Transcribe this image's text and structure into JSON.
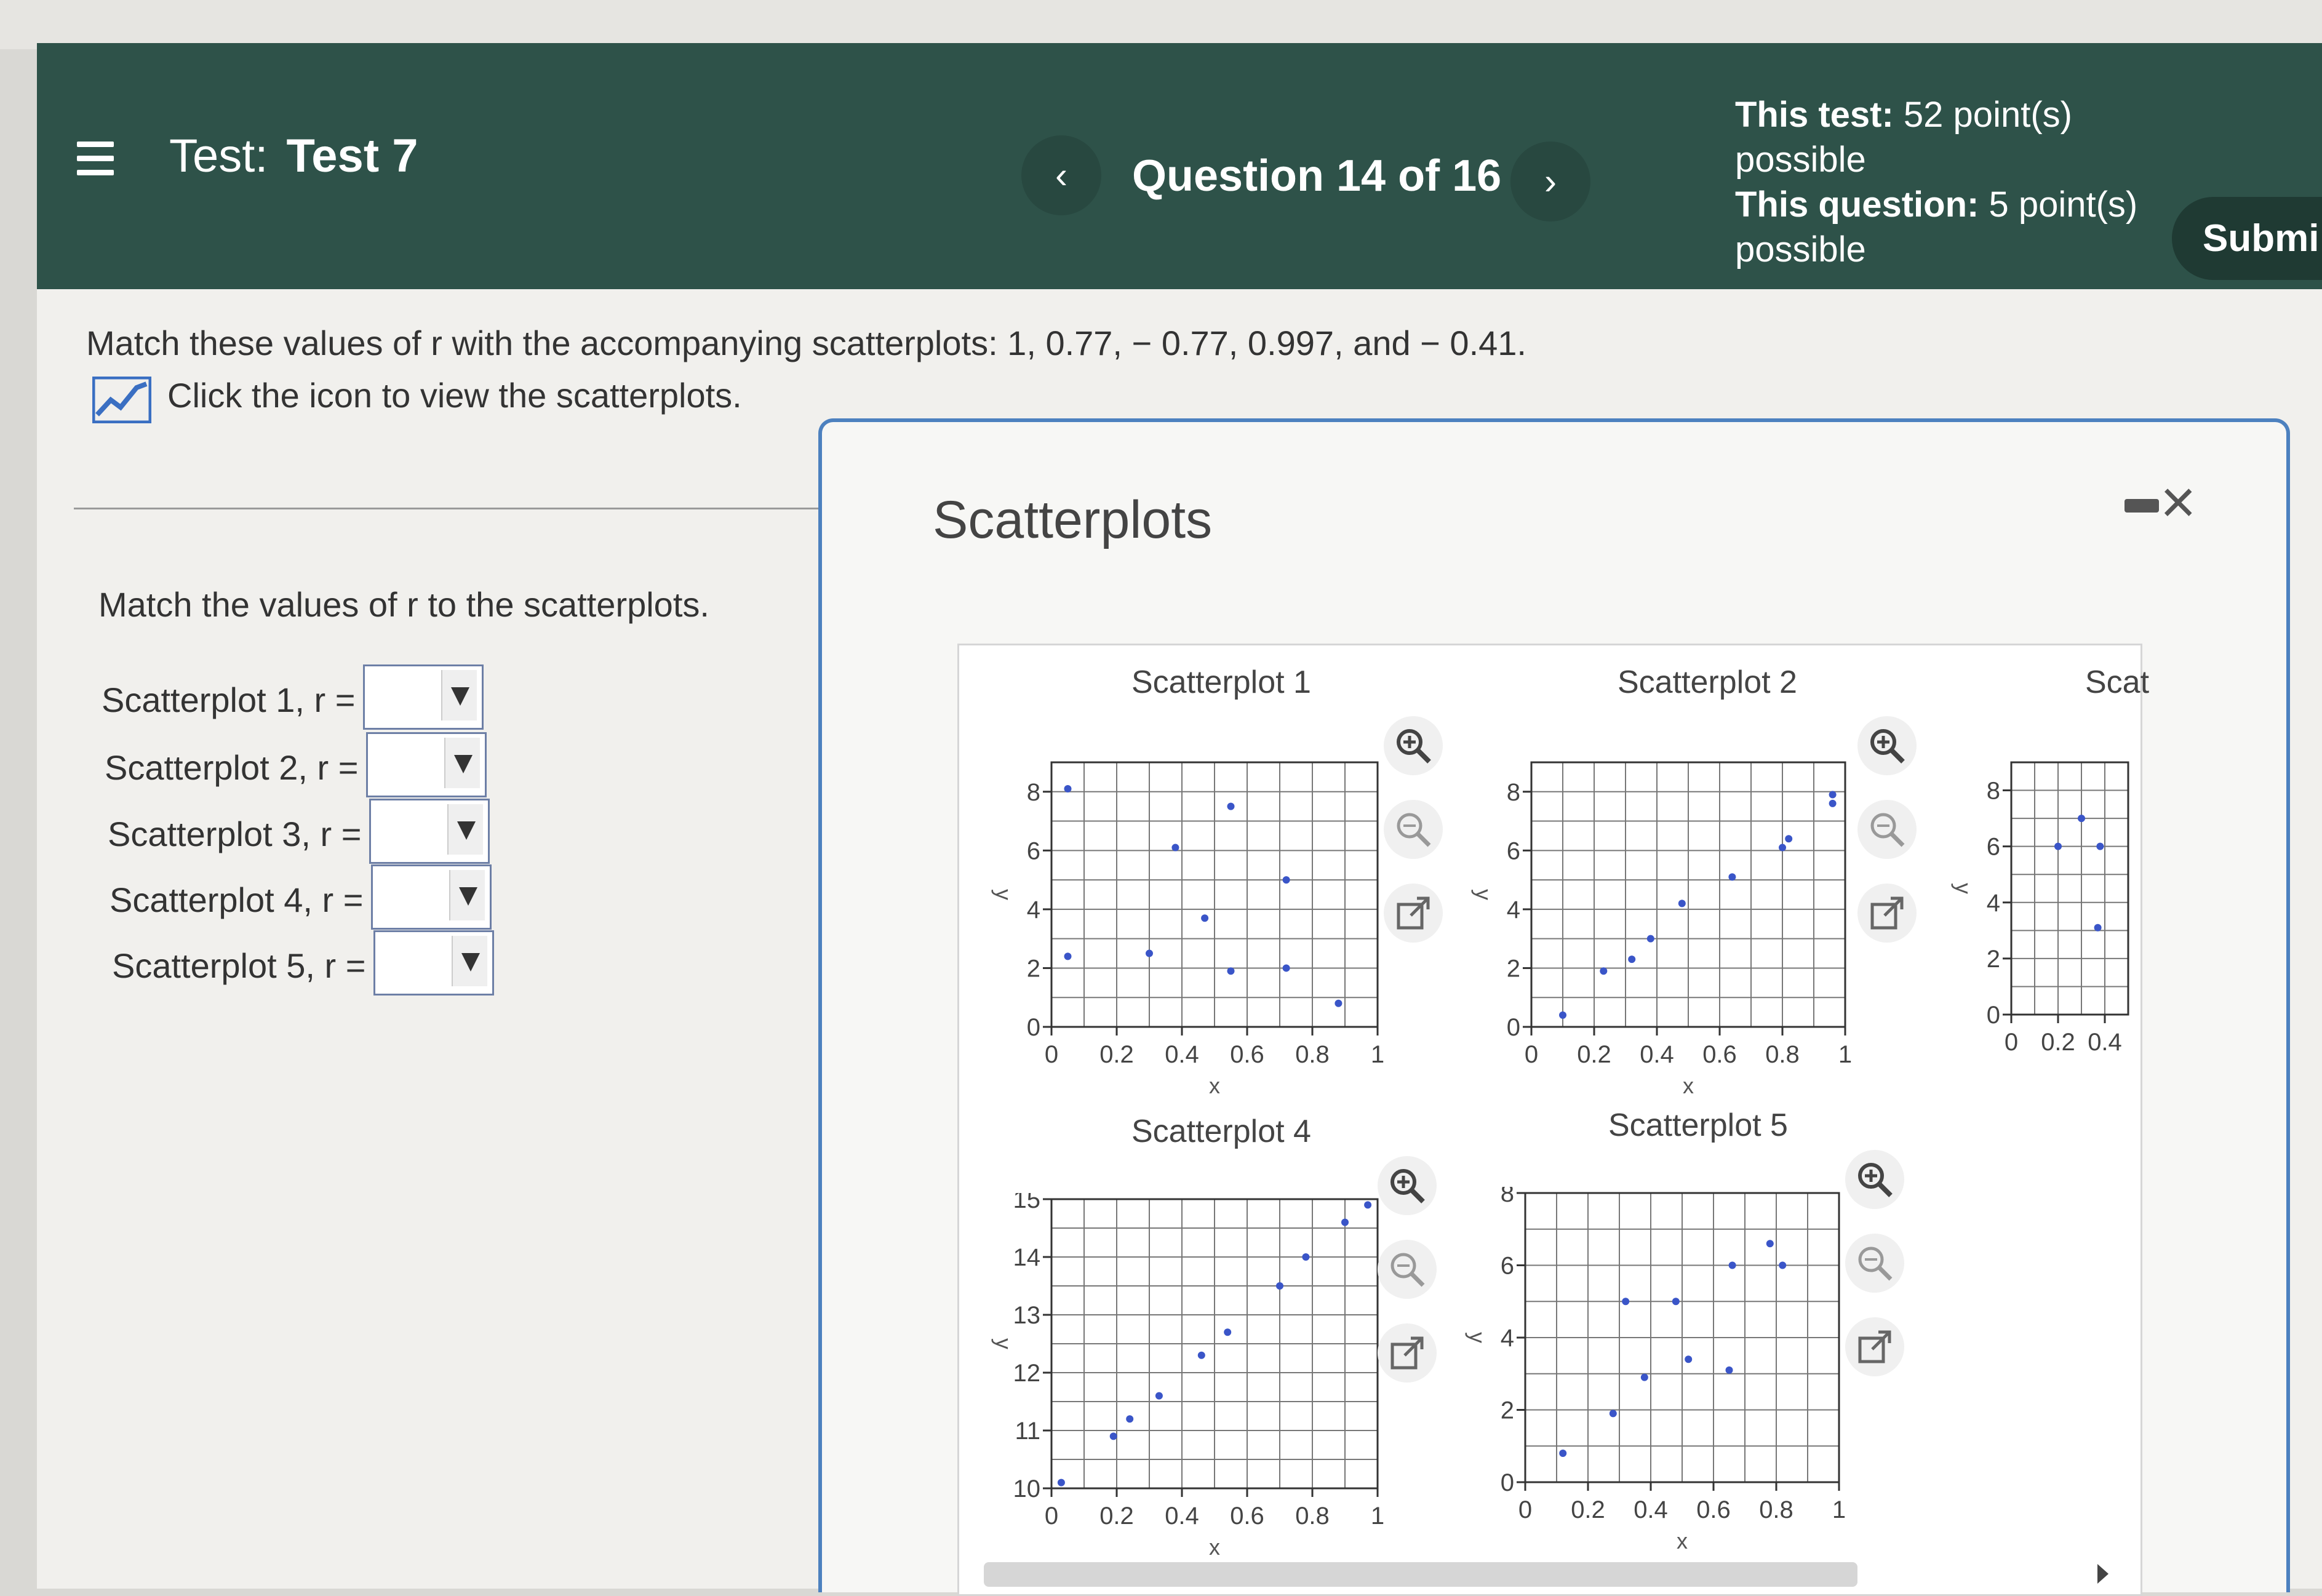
{
  "header": {
    "test_prefix": "Test:",
    "test_name": "Test 7",
    "question_label": "Question 14 of 16",
    "prev_symbol": "‹",
    "next_symbol": "›",
    "this_test_label": "This test:",
    "this_test_value": " 52 point(s) possible",
    "this_question_label": "This question:",
    "this_question_value": " 5 point(s) possible",
    "submit_label": "Submi"
  },
  "question": {
    "instructions": "Match these values of r with the accompanying scatterplots: 1, 0.77, − 0.77, 0.997, and − 0.41.",
    "view_link": "Click the icon to view the scatterplots.",
    "match_title": "Match the values of r to the scatterplots.",
    "rows": [
      {
        "label": "Scatterplot 1, r =",
        "value": ""
      },
      {
        "label": "Scatterplot 2, r =",
        "value": ""
      },
      {
        "label": "Scatterplot 3, r =",
        "value": ""
      },
      {
        "label": "Scatterplot 4, r =",
        "value": ""
      },
      {
        "label": "Scatterplot 5, r =",
        "value": ""
      }
    ]
  },
  "modal": {
    "title": "Scatterplots",
    "minimize_icon": "minimize-icon",
    "close_icon": "close-icon"
  },
  "colors": {
    "header_bg": "#2e5249",
    "modal_border": "#4d81bf",
    "point": "#3a55c8",
    "dropdown_border": "#6d7fa6"
  },
  "chart_data": [
    {
      "type": "scatter",
      "title": "Scatterplot 1",
      "xlabel": "x",
      "ylabel": "y",
      "xlim": [
        0,
        1
      ],
      "ylim": [
        0,
        9
      ],
      "xticks": [
        "0",
        "0.2",
        "0.4",
        "0.6",
        "0.8",
        "1"
      ],
      "yticks": [
        "0",
        "2",
        "4",
        "6",
        "8"
      ],
      "grid": true,
      "points": [
        [
          0.05,
          8.1
        ],
        [
          0.05,
          2.4
        ],
        [
          0.3,
          2.5
        ],
        [
          0.38,
          6.1
        ],
        [
          0.47,
          3.7
        ],
        [
          0.55,
          7.5
        ],
        [
          0.55,
          1.9
        ],
        [
          0.72,
          5.0
        ],
        [
          0.72,
          2.0
        ],
        [
          0.88,
          0.8
        ]
      ]
    },
    {
      "type": "scatter",
      "title": "Scatterplot 2",
      "xlabel": "x",
      "ylabel": "y",
      "xlim": [
        0,
        1
      ],
      "ylim": [
        0,
        9
      ],
      "xticks": [
        "0",
        "0.2",
        "0.4",
        "0.6",
        "0.8",
        "1"
      ],
      "yticks": [
        "0",
        "2",
        "4",
        "6",
        "8"
      ],
      "grid": true,
      "points": [
        [
          0.1,
          0.4
        ],
        [
          0.23,
          1.9
        ],
        [
          0.32,
          2.3
        ],
        [
          0.38,
          3.0
        ],
        [
          0.48,
          4.2
        ],
        [
          0.64,
          5.1
        ],
        [
          0.8,
          6.1
        ],
        [
          0.82,
          6.4
        ],
        [
          0.96,
          7.9
        ],
        [
          0.96,
          7.6
        ]
      ]
    },
    {
      "type": "scatter",
      "title": "Scat",
      "xlabel": "",
      "ylabel": "y",
      "xlim": [
        0,
        0.5
      ],
      "ylim": [
        0,
        9
      ],
      "xticks": [
        "0",
        "0.2",
        "0.4"
      ],
      "yticks": [
        "0",
        "2",
        "4",
        "6",
        "8"
      ],
      "grid": true,
      "points": [
        [
          0.2,
          6.0
        ],
        [
          0.3,
          7.0
        ],
        [
          0.38,
          6.0
        ],
        [
          0.37,
          3.1
        ]
      ]
    },
    {
      "type": "scatter",
      "title": "Scatterplot 4",
      "xlabel": "x",
      "ylabel": "y",
      "xlim": [
        0,
        1
      ],
      "ylim": [
        10,
        15
      ],
      "xticks": [
        "0",
        "0.2",
        "0.4",
        "0.6",
        "0.8",
        "1"
      ],
      "yticks": [
        "10",
        "11",
        "12",
        "13",
        "14",
        "15"
      ],
      "grid": true,
      "points": [
        [
          0.03,
          10.1
        ],
        [
          0.19,
          10.9
        ],
        [
          0.24,
          11.2
        ],
        [
          0.33,
          11.6
        ],
        [
          0.46,
          12.3
        ],
        [
          0.54,
          12.7
        ],
        [
          0.7,
          13.5
        ],
        [
          0.78,
          14.0
        ],
        [
          0.9,
          14.6
        ],
        [
          0.97,
          14.9
        ]
      ]
    },
    {
      "type": "scatter",
      "title": "Scatterplot 5",
      "xlabel": "x",
      "ylabel": "y",
      "xlim": [
        0,
        1
      ],
      "ylim": [
        0,
        8
      ],
      "xticks": [
        "0",
        "0.2",
        "0.4",
        "0.6",
        "0.8",
        "1"
      ],
      "yticks": [
        "0",
        "2",
        "4",
        "6",
        "8"
      ],
      "grid": true,
      "points": [
        [
          0.12,
          0.8
        ],
        [
          0.28,
          1.9
        ],
        [
          0.32,
          5.0
        ],
        [
          0.38,
          2.9
        ],
        [
          0.48,
          5.0
        ],
        [
          0.52,
          3.4
        ],
        [
          0.65,
          3.1
        ],
        [
          0.66,
          6.0
        ],
        [
          0.78,
          6.6
        ],
        [
          0.82,
          6.0
        ]
      ]
    }
  ]
}
